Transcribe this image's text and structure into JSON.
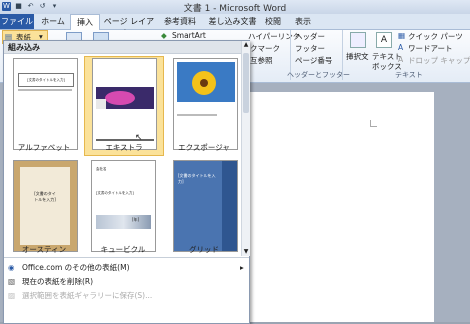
{
  "window": {
    "title": "文書 1 - Microsoft Word"
  },
  "tabs": [
    "ファイル",
    "ホーム",
    "挿入",
    "ページ レイアウト",
    "参考資料",
    "差し込み文書",
    "校閲",
    "表示"
  ],
  "ribbon": {
    "cover_button": "表紙",
    "smartart": "SmartArt",
    "hyperlink": "ハイパーリンク",
    "bookmark": "クマーク",
    "crossref": "互参照",
    "header": "ヘッダー",
    "footer": "フッター",
    "page_number": "ページ番号",
    "header_footer_group": "ヘッダーとフッター",
    "annotation": "挿択文",
    "textbox_line1": "テキスト",
    "textbox_line2": "ボックス",
    "quickparts": "クイック パーツ",
    "wordart": "ワードアート",
    "dropcap": "ドロップ キャップ",
    "text_group": "テキスト"
  },
  "gallery": {
    "header": "組み込み",
    "items": [
      {
        "name": "アルファベット",
        "selected": false
      },
      {
        "name": "エキストラ",
        "selected": true
      },
      {
        "name": "エクスポージャ",
        "selected": false
      },
      {
        "name": "オースティン",
        "selected": false
      },
      {
        "name": "キュービクル",
        "selected": false
      },
      {
        "name": "グリッド",
        "selected": false
      }
    ],
    "thumb_text": {
      "title_placeholder": "[文書のタイトルを入力]",
      "title_short_1": "[文書のタイ",
      "title_short_2": "トルを入力]",
      "year": "[年]",
      "small_label": "会社名"
    },
    "menu": [
      {
        "label": "Office.com のその他の表紙(M)",
        "enabled": true
      },
      {
        "label": "現在の表紙を削除(R)",
        "enabled": true
      },
      {
        "label": "選択範囲を表紙ギャラリーに保存(S)...",
        "enabled": false
      }
    ]
  },
  "colors": {
    "accent": "#2a5aa6",
    "selected": "#fbe29a"
  }
}
